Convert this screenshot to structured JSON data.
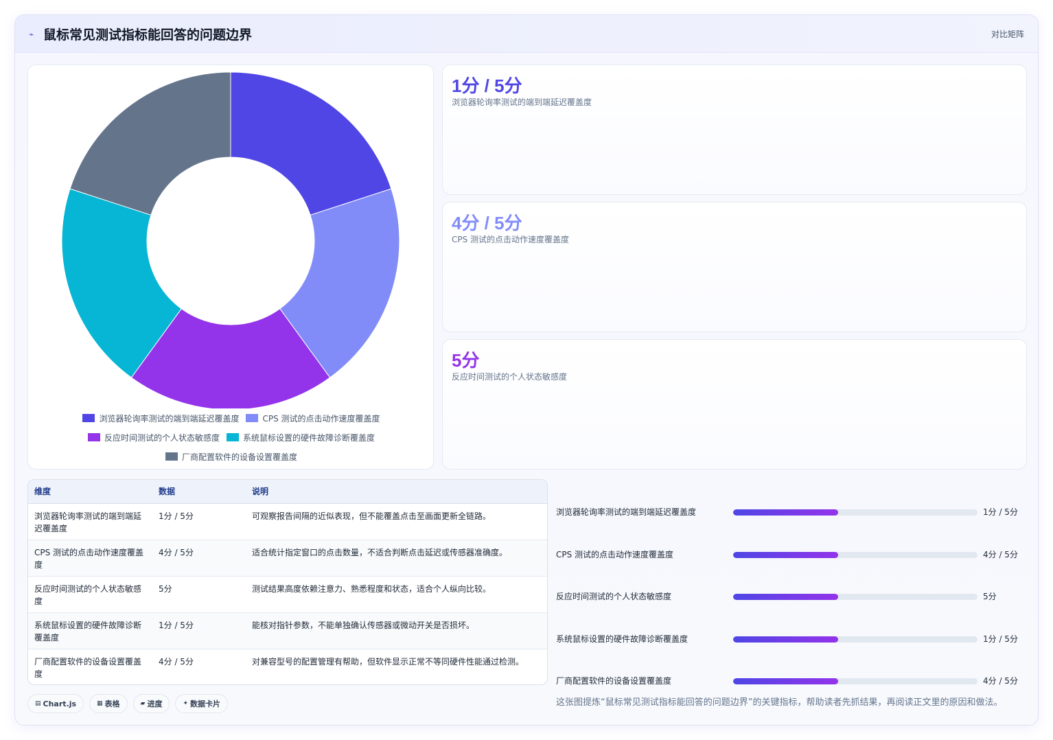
{
  "header": {
    "icon": "chart-line-icon",
    "icon_glyph": "⌁",
    "title": "鼠标常见测试指标能回答的问题边界",
    "link": "对比矩阵"
  },
  "colors": {
    "indigo": "#4f46e5",
    "periwinkle": "#818cf8",
    "purple": "#9333ea",
    "cyan": "#06b6d4",
    "slate": "#64748b"
  },
  "chart_data": {
    "type": "pie",
    "categories": [
      "浏览器轮询率测试的端到端延迟覆盖度",
      "CPS 测试的点击动作速度覆盖度",
      "反应时间测试的个人状态敏感度",
      "系统鼠标设置的硬件故障诊断覆盖度",
      "厂商配置软件的设备设置覆盖度"
    ],
    "values": [
      1,
      1,
      1,
      1,
      1
    ],
    "colors": [
      "#4f46e5",
      "#818cf8",
      "#9333ea",
      "#06b6d4",
      "#64748b"
    ],
    "legend_position": "bottom"
  },
  "stats": [
    {
      "value": "1分 / 5分",
      "label": "浏览器轮询率测试的端到端延迟覆盖度",
      "color": "#4f46e5"
    },
    {
      "value": "4分 / 5分",
      "label": "CPS 测试的点击动作速度覆盖度",
      "color": "#818cf8"
    },
    {
      "value": "5分",
      "label": "反应时间测试的个人状态敏感度",
      "color": "#9333ea"
    }
  ],
  "table": {
    "headers": [
      "维度",
      "数据",
      "说明"
    ],
    "rows": [
      [
        "浏览器轮询率测试的端到端延迟覆盖度",
        "1分 / 5分",
        "可观察报告间隔的近似表现，但不能覆盖点击至画面更新全链路。"
      ],
      [
        "CPS 测试的点击动作速度覆盖度",
        "4分 / 5分",
        "适合统计指定窗口的点击数量，不适合判断点击延迟或传感器准确度。"
      ],
      [
        "反应时间测试的个人状态敏感度",
        "5分",
        "测试结果高度依赖注意力、熟悉程度和状态，适合个人纵向比较。"
      ],
      [
        "系统鼠标设置的硬件故障诊断覆盖度",
        "1分 / 5分",
        "能核对指针参数，不能单独确认传感器或微动开关是否损坏。"
      ],
      [
        "厂商配置软件的设备设置覆盖度",
        "4分 / 5分",
        "对兼容型号的配置管理有帮助，但软件显示正常不等同硬件性能通过检测。"
      ]
    ]
  },
  "progress": [
    {
      "label": "浏览器轮询率测试的端到端延迟覆盖度",
      "value": "1分 / 5分",
      "fill": 0.43
    },
    {
      "label": "CPS 测试的点击动作速度覆盖度",
      "value": "4分 / 5分",
      "fill": 0.43
    },
    {
      "label": "反应时间测试的个人状态敏感度",
      "value": "5分",
      "fill": 0.43
    },
    {
      "label": "系统鼠标设置的硬件故障诊断覆盖度",
      "value": "1分 / 5分",
      "fill": 0.43
    },
    {
      "label": "厂商配置软件的设备设置覆盖度",
      "value": "4分 / 5分",
      "fill": 0.43
    }
  ],
  "caption": "这张图提炼“鼠标常见测试指标能回答的问题边界”的关键指标，帮助读者先抓结果，再阅读正文里的原因和做法。",
  "chips": [
    {
      "icon": "▤",
      "label": "Chart.js"
    },
    {
      "icon": "▦",
      "label": "表格"
    },
    {
      "icon": "▰",
      "label": "进度"
    },
    {
      "icon": "✦",
      "label": "数据卡片"
    }
  ]
}
